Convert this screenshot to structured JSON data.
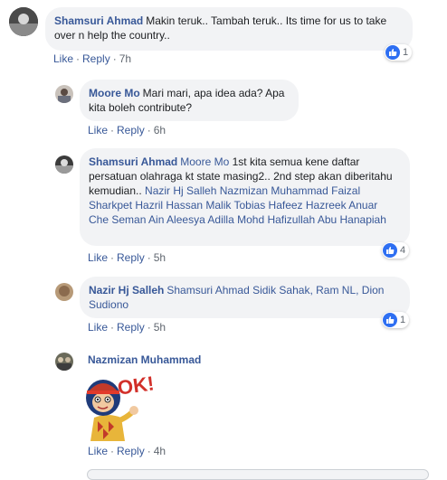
{
  "comments": [
    {
      "author": "Shamsuri Ahmad",
      "text": "Makin teruk.. Tambah teruk.. Its time for us to take over n help the country..",
      "like_label": "Like",
      "reply_label": "Reply",
      "time": "7h",
      "reaction_count": "1"
    },
    {
      "author": "Moore Mo",
      "text": "Mari mari, apa idea ada? Apa kita boleh contribute?",
      "like_label": "Like",
      "reply_label": "Reply",
      "time": "6h"
    },
    {
      "author": "Shamsuri Ahmad",
      "mention_first": "Moore Mo",
      "text": "1st kita semua kene daftar persatuan olahraga kt state masing2.. 2nd step akan diberitahu kemudian..",
      "mentions": "Nazir Hj Salleh Nazmizan Muhammad Faizal Sharkpet Hazril Hassan Malik Tobias Hafeez Hazreek Anuar Che Seman Ain Aleesya Adilla Mohd Hafizullah Abu Hanapiah",
      "like_label": "Like",
      "reply_label": "Reply",
      "time": "5h",
      "reaction_count": "4"
    },
    {
      "author": "Nazir Hj Salleh",
      "mentions": "Shamsuri Ahmad Sidik Sahak, Ram NL, Dion Sudiono",
      "like_label": "Like",
      "reply_label": "Reply",
      "time": "5h",
      "reaction_count": "1"
    },
    {
      "author": "Nazmizan Muhammad",
      "sticker_text": "OK!",
      "like_label": "Like",
      "reply_label": "Reply",
      "time": "4h"
    }
  ],
  "icons": {
    "reaction": "like-thumb-icon",
    "sticker": "ok-sticker"
  },
  "colors": {
    "link": "#385898",
    "bubble": "#f2f3f5",
    "meta": "#606770",
    "like_blue": "#2e6ff2"
  }
}
